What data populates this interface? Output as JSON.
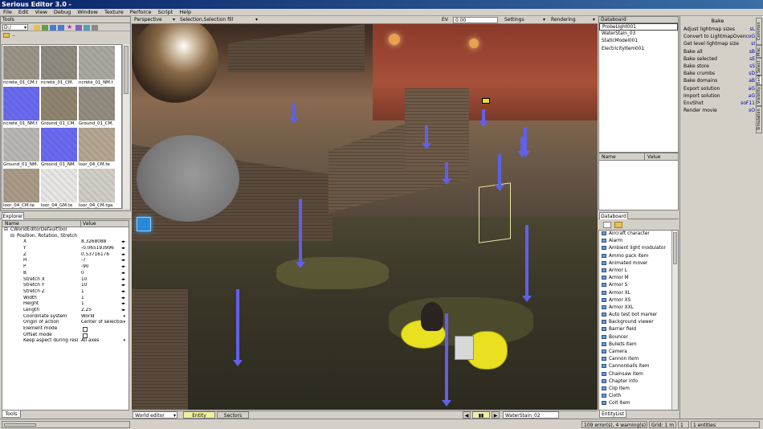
{
  "window": {
    "title": "Serious Editor 3.0 -"
  },
  "menu": [
    "File",
    "Edit",
    "View",
    "Debug",
    "Window",
    "Texture",
    "Perforce",
    "Script",
    "Help"
  ],
  "tools": {
    "header": "Tools",
    "drive": "D:/",
    "folder_item": "..",
    "thumbnails": [
      {
        "label": "ncrete_01_CM.t",
        "color": "#9a9486"
      },
      {
        "label": "ncrete_01_CM.",
        "color": "#8e8a80"
      },
      {
        "label": "ncrete_01_NM.t",
        "color": "#aaa7a0"
      },
      {
        "label": "ncrete_01_NM.t",
        "color": "#6a6af0"
      },
      {
        "label": "Ground_01_CM.",
        "color": "#8e8470"
      },
      {
        "label": "Ground_01_CM.",
        "color": "#938c80"
      },
      {
        "label": "Ground_01_NM.",
        "color": "#b8b6b2"
      },
      {
        "label": "Ground_01_NM.",
        "color": "#6a6af0"
      },
      {
        "label": "loor_04_CM.te",
        "color": "#b4a692"
      },
      {
        "label": "loor_04_CM.te",
        "color": "#a89a86"
      },
      {
        "label": "loor_04_GM.te",
        "color": "#e8e6e4"
      },
      {
        "label": "loor_04_CM.tga",
        "color": "#d0ccc6"
      }
    ]
  },
  "explorer": {
    "tab": "Explorer",
    "col_name": "Name",
    "col_value": "Value",
    "root": "CWorldEditorDefaultTool",
    "group": "Position, Rotation, Stretch",
    "rows": [
      {
        "name": "X",
        "value": "8.3268088"
      },
      {
        "name": "Y",
        "value": "-0.065193996"
      },
      {
        "name": "Z",
        "value": "0.53716176"
      },
      {
        "name": "H",
        "value": "-7"
      },
      {
        "name": "P",
        "value": "-90"
      },
      {
        "name": "B",
        "value": "0"
      },
      {
        "name": "Stretch X",
        "value": "10"
      },
      {
        "name": "Stretch Y",
        "value": "10"
      },
      {
        "name": "Stretch Z",
        "value": "1"
      },
      {
        "name": "Width",
        "value": "1"
      },
      {
        "name": "Height",
        "value": "1"
      },
      {
        "name": "Length",
        "value": "2.25"
      },
      {
        "name": "Coordinate system",
        "value": "World"
      },
      {
        "name": "Origin of action",
        "value": "Center of selection"
      },
      {
        "name": "Element mode",
        "value": ""
      },
      {
        "name": "Offset mode",
        "value": ""
      },
      {
        "name": "Keep aspect during resize",
        "value": "All axes"
      }
    ],
    "bottom_tab": "Tools"
  },
  "viewport": {
    "projection": "Perspective",
    "selection": "Selection,Selection fill",
    "ev_label": "EV",
    "ev_value": "0.00",
    "settings": "Settings",
    "rendering": "Rendering",
    "mode": "World editor",
    "tab_entity": "Entity",
    "tab_sectors": "Sectors",
    "selected_name": "WaterStain_02"
  },
  "databoard_top": {
    "header": "Databoard",
    "items": [
      "ProbeLight001",
      "WaterStain_03",
      "StaticModel001",
      "ElectricityItem001"
    ],
    "col_name": "Name",
    "col_value": "Value"
  },
  "databoard_bottom": {
    "tab": "Databoard",
    "items": [
      "Aircraft character",
      "Alarm",
      "Ambient light modulator",
      "Ammo pack item",
      "Animated mover",
      "Armor L",
      "Armor M",
      "Armor S",
      "Armor XL",
      "Armor XS",
      "Armor XXL",
      "Auto test bot marker",
      "Background viewer",
      "Barrier field",
      "Bouncer",
      "Bullets item",
      "Camera",
      "Cannon item",
      "Cannonballs item",
      "Chainsaw item",
      "Chapter info",
      "Clip item",
      "Cloth",
      "Colt item"
    ],
    "bottom_tab": "EntityList"
  },
  "bake": {
    "title": "Bake",
    "items": [
      {
        "label": "Adjust lightmap sizes",
        "key": "sL"
      },
      {
        "label": "Convert to LightmapOven",
        "key": "coG"
      },
      {
        "label": "Get level lightmap size",
        "key": "sI"
      },
      {
        "label": "Bake all",
        "key": "sB"
      },
      {
        "label": "Bake selected",
        "key": "sE"
      },
      {
        "label": "Bake store",
        "key": "sS"
      },
      {
        "label": "Bake crumbs",
        "key": "sD"
      },
      {
        "label": "Bake domains",
        "key": "aB"
      },
      {
        "label": "Export solution",
        "key": "aG"
      },
      {
        "label": "Import solution",
        "key": "aG"
      },
      {
        "label": "EnvShot",
        "key": "soF11"
      },
      {
        "label": "Render movie",
        "key": "sO"
      }
    ],
    "vtabs": [
      "Common",
      "Misc",
      "Select",
      "Bake",
      "Visibility",
      "Simulation"
    ]
  },
  "status": {
    "errors": "109 error(s), 4 warning(s)",
    "grid": "Grid: 1 m",
    "count": "1",
    "entities": "1 entities"
  }
}
